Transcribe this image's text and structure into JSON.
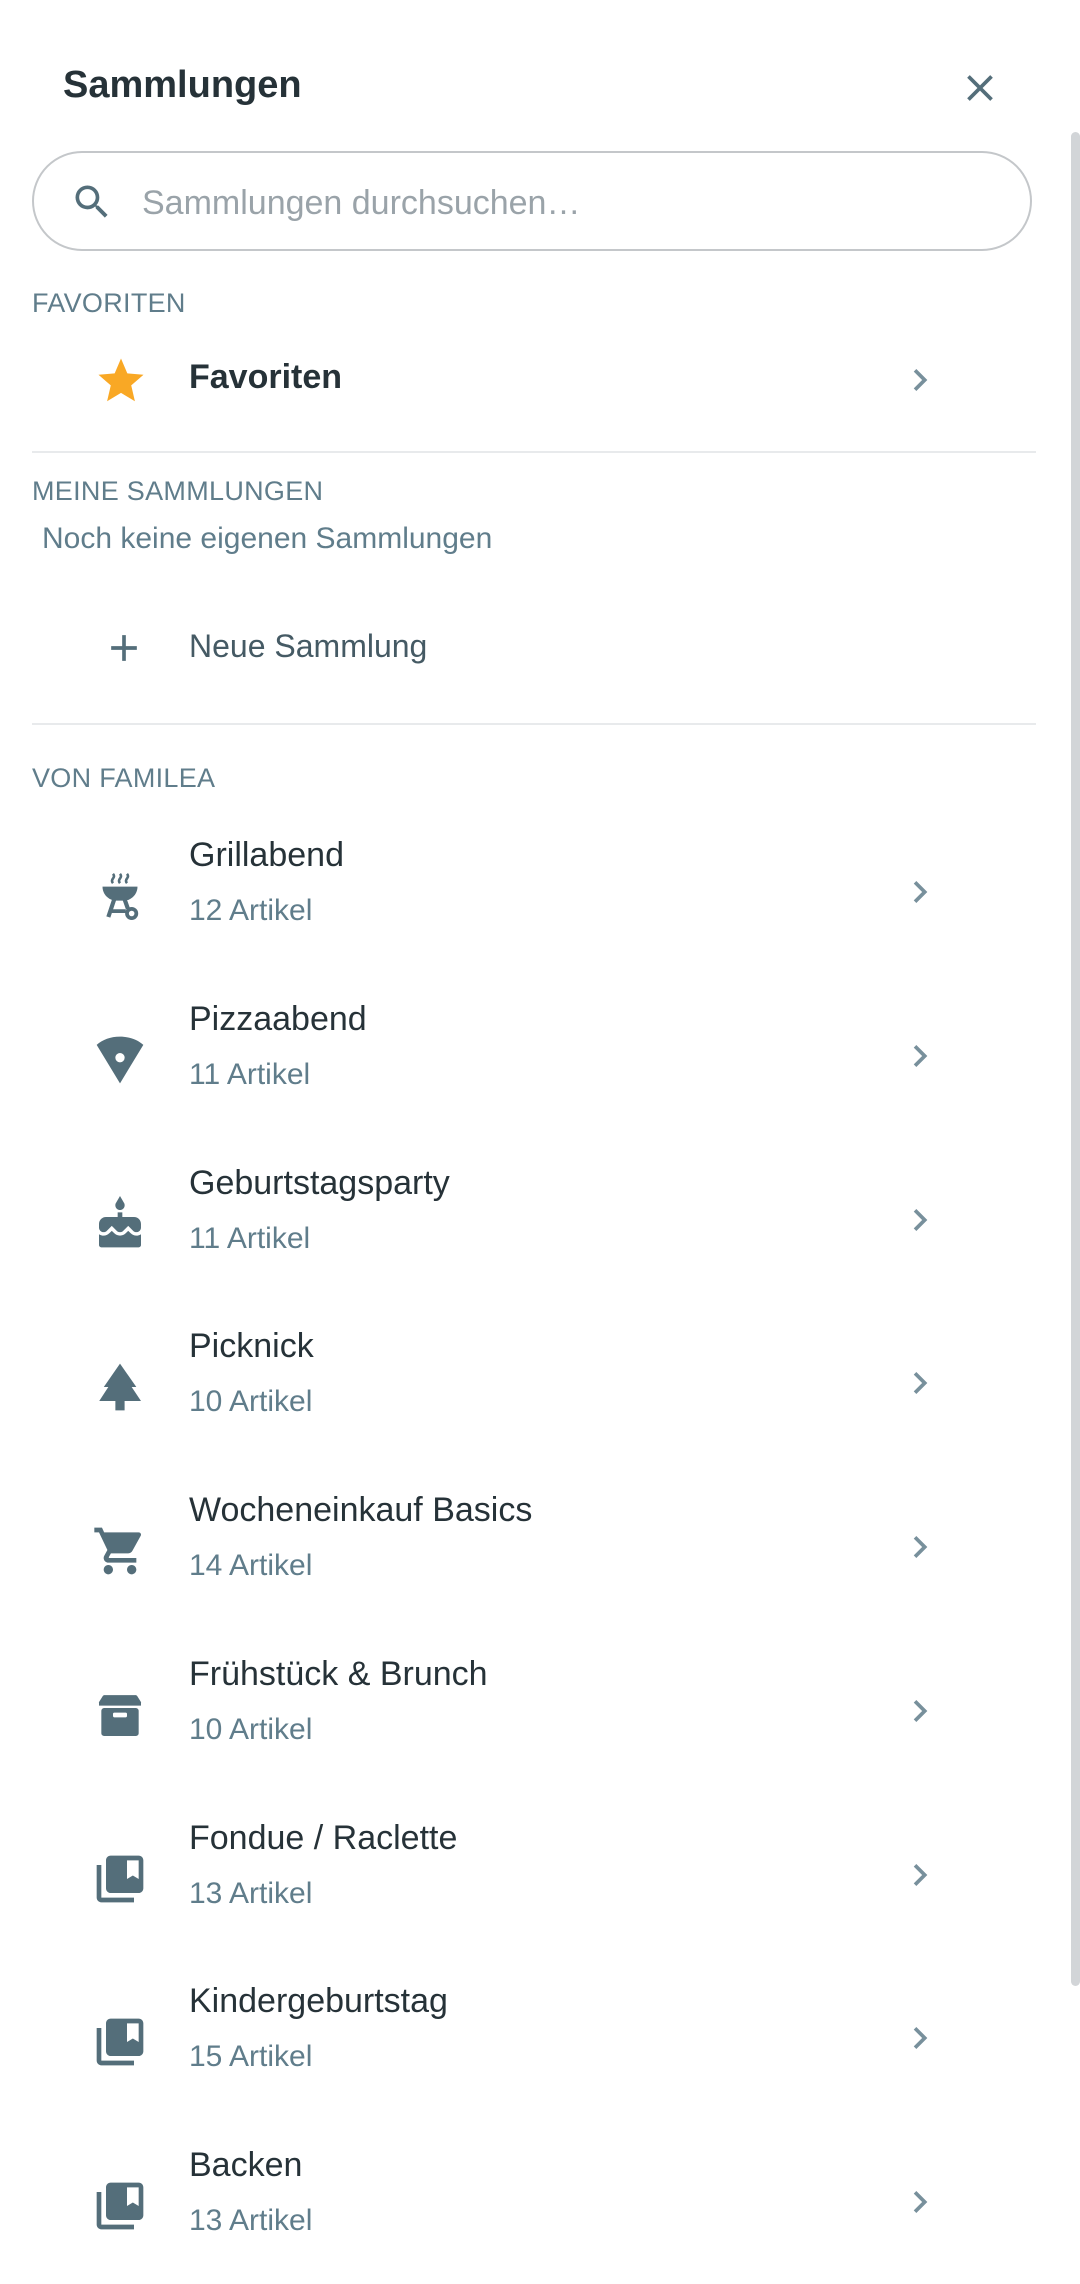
{
  "header": {
    "title": "Sammlungen"
  },
  "search": {
    "placeholder": "Sammlungen durchsuchen…",
    "value": ""
  },
  "favorites_section": {
    "label": "FAVORITEN",
    "item": {
      "name": "Favoriten",
      "icon": "star-icon",
      "icon_color": "#F9A825"
    }
  },
  "my_collections": {
    "label": "MEINE SAMMLUNGEN",
    "empty_note": "Noch keine eigenen Sammlungen",
    "new_label": "Neue Sammlung"
  },
  "familea": {
    "label": "VON FAMILEA",
    "items": [
      {
        "name": "Grillabend",
        "count": "12 Artikel",
        "icon": "grill-icon"
      },
      {
        "name": "Pizzaabend",
        "count": "11 Artikel",
        "icon": "pizza-icon"
      },
      {
        "name": "Geburtstagsparty",
        "count": "11 Artikel",
        "icon": "cake-icon"
      },
      {
        "name": "Picknick",
        "count": "10 Artikel",
        "icon": "tree-icon"
      },
      {
        "name": "Wocheneinkauf Basics",
        "count": "14 Artikel",
        "icon": "cart-icon"
      },
      {
        "name": "Frühstück & Brunch",
        "count": "10 Artikel",
        "icon": "store-icon"
      },
      {
        "name": "Fondue / Raclette",
        "count": "13 Artikel",
        "icon": "library-icon"
      },
      {
        "name": "Kindergeburtstag",
        "count": "15 Artikel",
        "icon": "library-icon"
      },
      {
        "name": "Backen",
        "count": "13 Artikel",
        "icon": "library-icon"
      }
    ]
  },
  "colors": {
    "text_primary": "#263238",
    "text_secondary": "#607D8B",
    "icon": "#546E7A",
    "accent_star": "#F9A825"
  }
}
